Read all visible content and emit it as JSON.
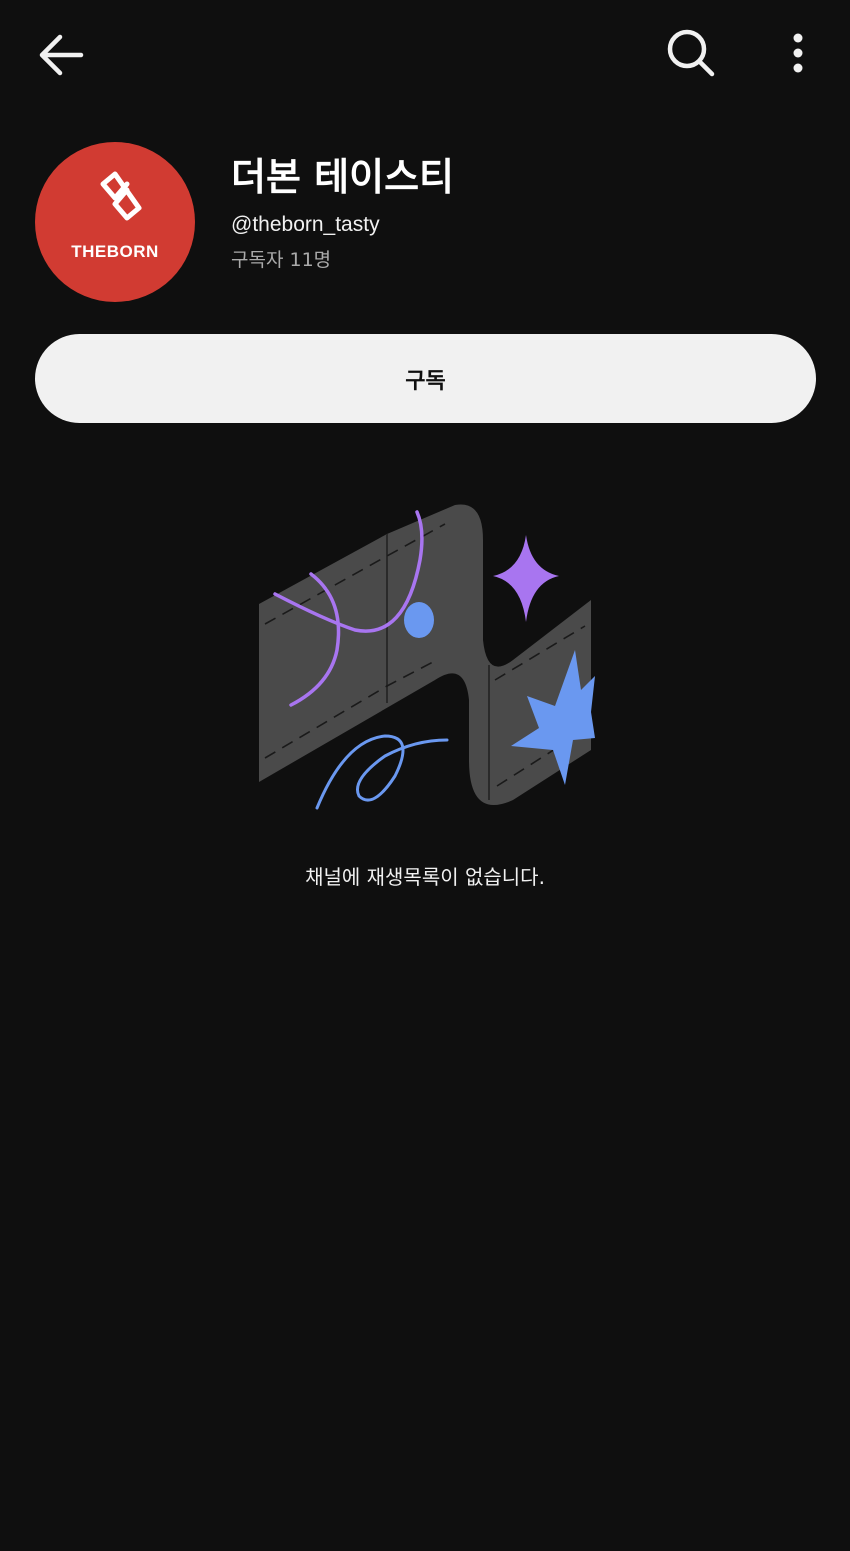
{
  "topbar": {
    "back_icon": "arrow-left-icon",
    "search_icon": "search-icon",
    "more_icon": "more-vert-icon"
  },
  "channel": {
    "avatar_brand_text": "THEBORN",
    "avatar_bg_color": "#d13b32",
    "name": "더본 테이스티",
    "handle": "@theborn_tasty",
    "subscribers": "구독자 11명"
  },
  "subscribe_label": "구독",
  "empty_state": {
    "illustration_icon": "empty-playlist-illustration",
    "message": "채널에 재생목록이 없습니다."
  },
  "colors": {
    "background": "#0f0f0f",
    "button_bg": "#f1f1f1",
    "accent_purple": "#a875f0",
    "accent_blue": "#6a98f0"
  }
}
